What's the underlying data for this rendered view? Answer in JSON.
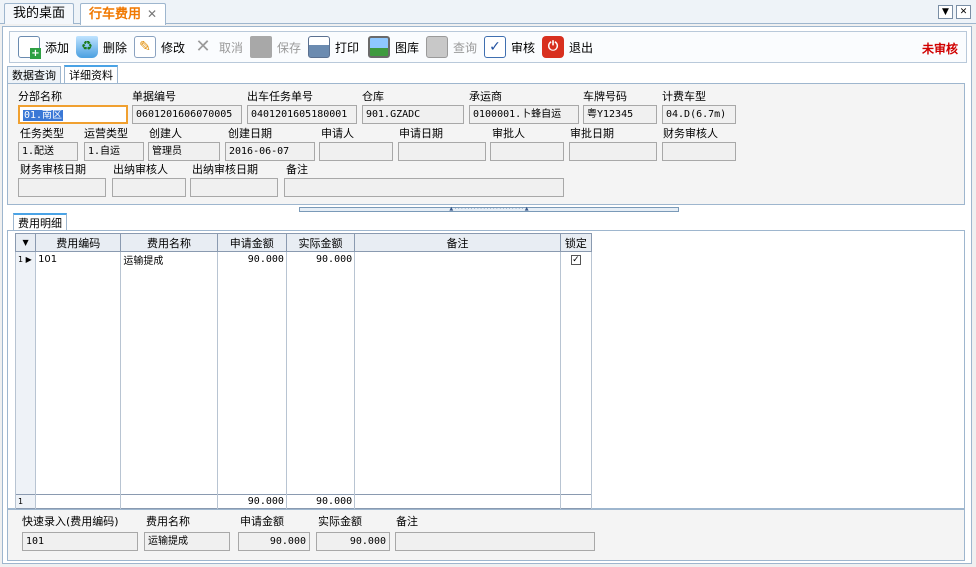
{
  "doc_tabs": [
    {
      "label": "我的桌面",
      "active": false
    },
    {
      "label": "行车费用",
      "active": true
    }
  ],
  "toolbar": {
    "add": "添加",
    "delete": "删除",
    "edit": "修改",
    "cancel": "取消",
    "save": "保存",
    "print": "打印",
    "gallery": "图库",
    "query": "查询",
    "audit": "审核",
    "exit": "退出"
  },
  "status": "未审核",
  "subtabs": {
    "query": "数据查询",
    "detail": "详细资料"
  },
  "form": {
    "branch": {
      "label": "分部名称",
      "value": "01.南区"
    },
    "doc_no": {
      "label": "单据编号",
      "value": "0601201606070005"
    },
    "task_no": {
      "label": "出车任务单号",
      "value": "0401201605180001"
    },
    "warehouse": {
      "label": "仓库",
      "value": "901.GZADC"
    },
    "carrier": {
      "label": "承运商",
      "value": "0100001.卜蜂自运"
    },
    "plate": {
      "label": "车牌号码",
      "value": "粤Y12345"
    },
    "vehicle_type": {
      "label": "计费车型",
      "value": "04.D(6.7m)"
    },
    "task_type": {
      "label": "任务类型",
      "value": "1.配送"
    },
    "op_type": {
      "label": "运营类型",
      "value": "1.自运"
    },
    "creator": {
      "label": "创建人",
      "value": "管理员"
    },
    "created": {
      "label": "创建日期",
      "value": "2016-06-07"
    },
    "applicant": {
      "label": "申请人",
      "value": ""
    },
    "apply_date": {
      "label": "申请日期",
      "value": ""
    },
    "approver": {
      "label": "审批人",
      "value": ""
    },
    "approve_date": {
      "label": "审批日期",
      "value": ""
    },
    "fin_auditor": {
      "label": "财务审核人",
      "value": ""
    },
    "fin_audit_date": {
      "label": "财务审核日期",
      "value": ""
    },
    "cashier": {
      "label": "出纳审核人",
      "value": ""
    },
    "cashier_date": {
      "label": "出纳审核日期",
      "value": ""
    },
    "remark": {
      "label": "备注",
      "value": ""
    }
  },
  "detail_tab": "费用明细",
  "grid": {
    "headers": [
      "费用编码",
      "费用名称",
      "申请金额",
      "实际金额",
      "备注",
      "锁定"
    ],
    "rows": [
      {
        "idx": "1",
        "code": "101",
        "name": "运输提成",
        "apply": "90.000",
        "actual": "90.000",
        "remark": "",
        "locked": true
      }
    ],
    "footer": {
      "idx": "1",
      "apply": "90.000",
      "actual": "90.000"
    }
  },
  "quick": {
    "code": {
      "label": "快速录入(费用编码)",
      "value": "101"
    },
    "name": {
      "label": "费用名称",
      "value": "运输提成"
    },
    "apply": {
      "label": "申请金额",
      "value": "90.000"
    },
    "actual": {
      "label": "实际金额",
      "value": "90.000"
    },
    "remark": {
      "label": "备注",
      "value": ""
    }
  }
}
